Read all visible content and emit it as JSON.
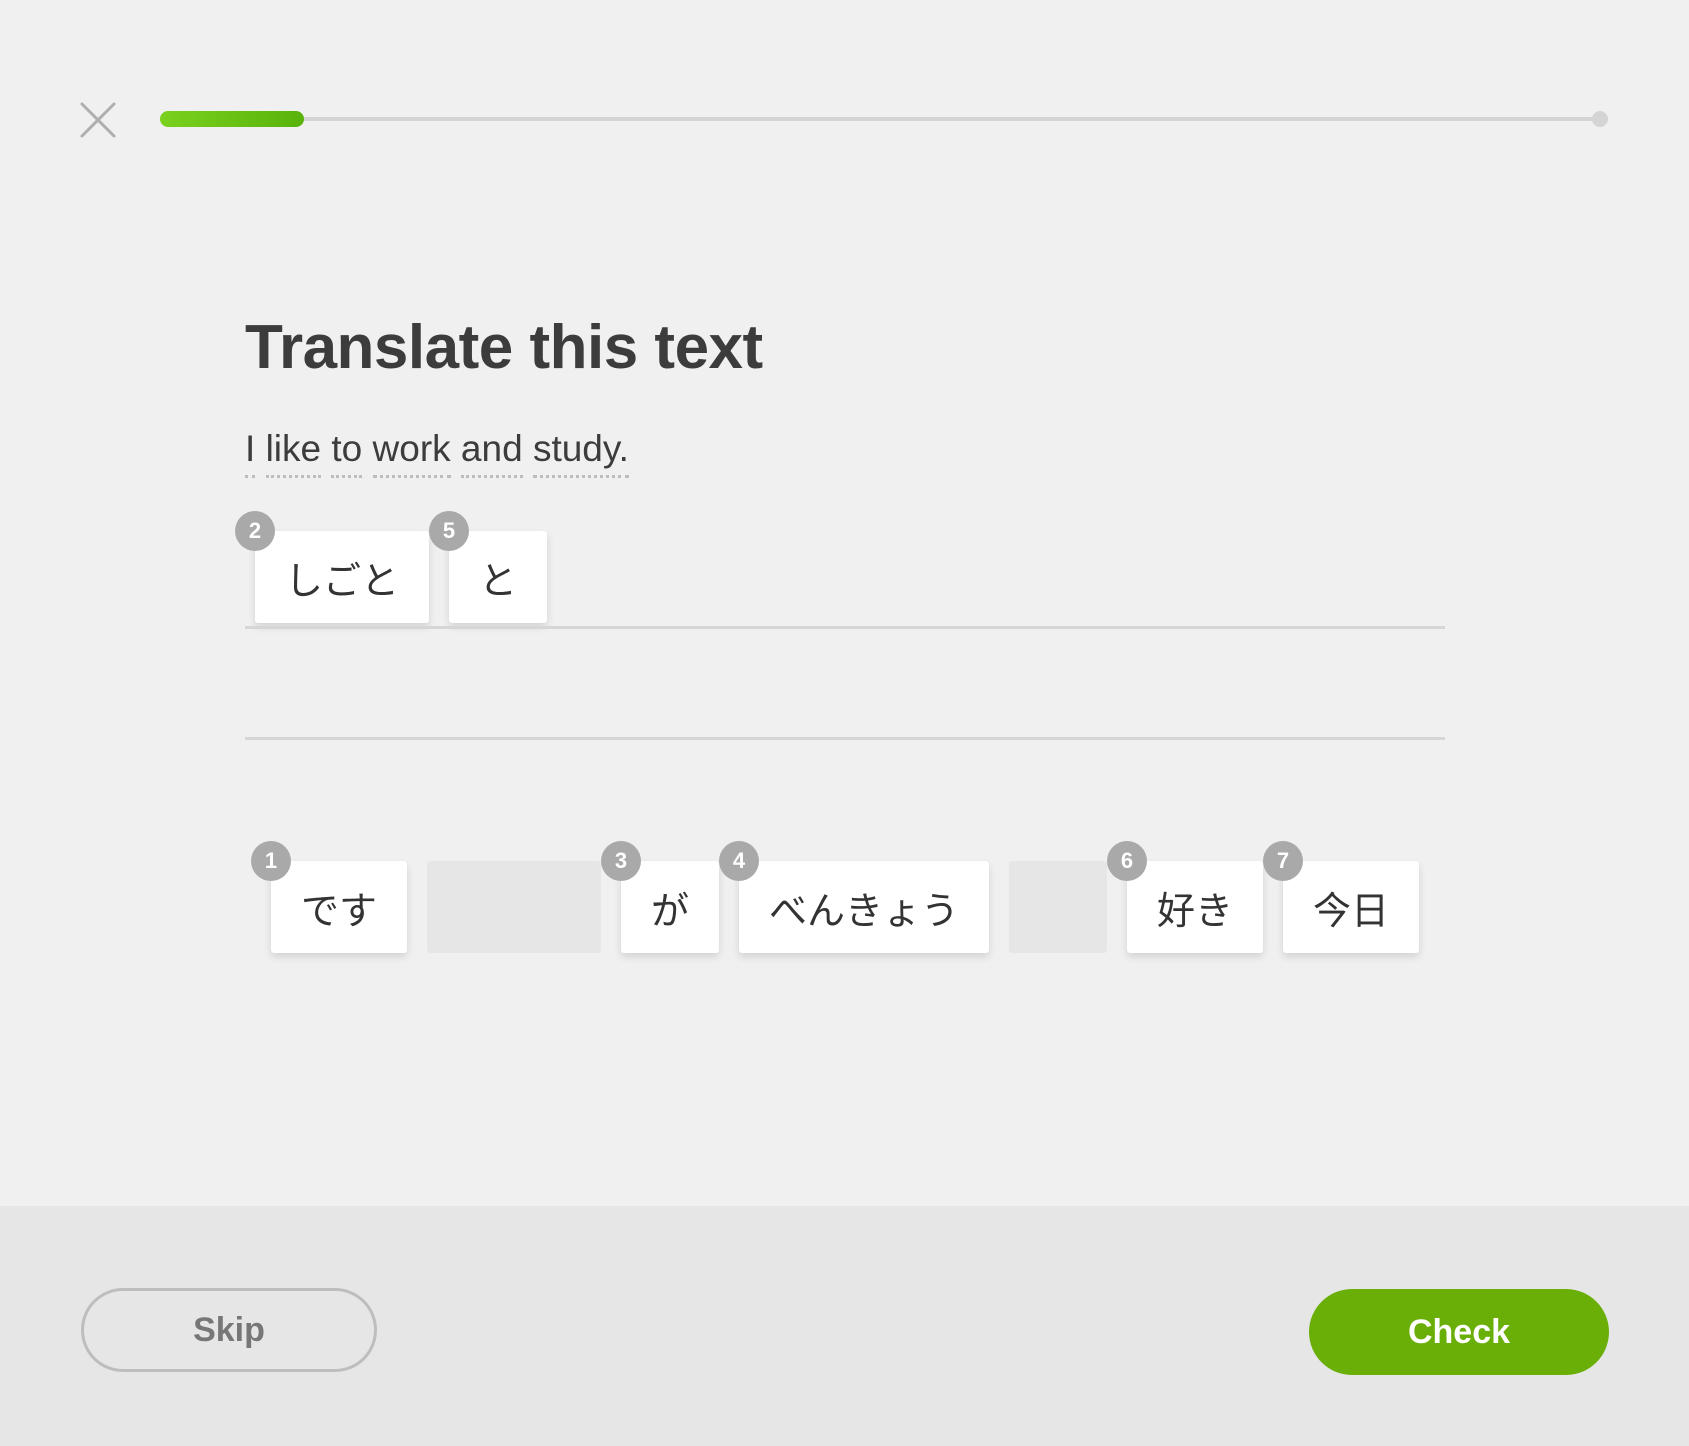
{
  "header": {
    "close_icon": "close-icon",
    "progress": 0.1,
    "progress_color": "#58b30a"
  },
  "main": {
    "title": "Translate this text",
    "prompt_words": [
      "I",
      "like",
      "to",
      "work",
      "and",
      "study."
    ]
  },
  "answer_tiles": [
    {
      "badge": "2",
      "text": "しごと"
    },
    {
      "badge": "5",
      "text": "と"
    }
  ],
  "word_bank": [
    {
      "badge": "1",
      "text": "です"
    },
    {
      "badge": "3",
      "text": "が"
    },
    {
      "badge": "4",
      "text": "べんきょう"
    },
    {
      "badge": "6",
      "text": "好き"
    },
    {
      "badge": "7",
      "text": "今日"
    }
  ],
  "footer": {
    "skip_label": "Skip",
    "check_label": "Check",
    "check_color": "#6aaf08"
  }
}
